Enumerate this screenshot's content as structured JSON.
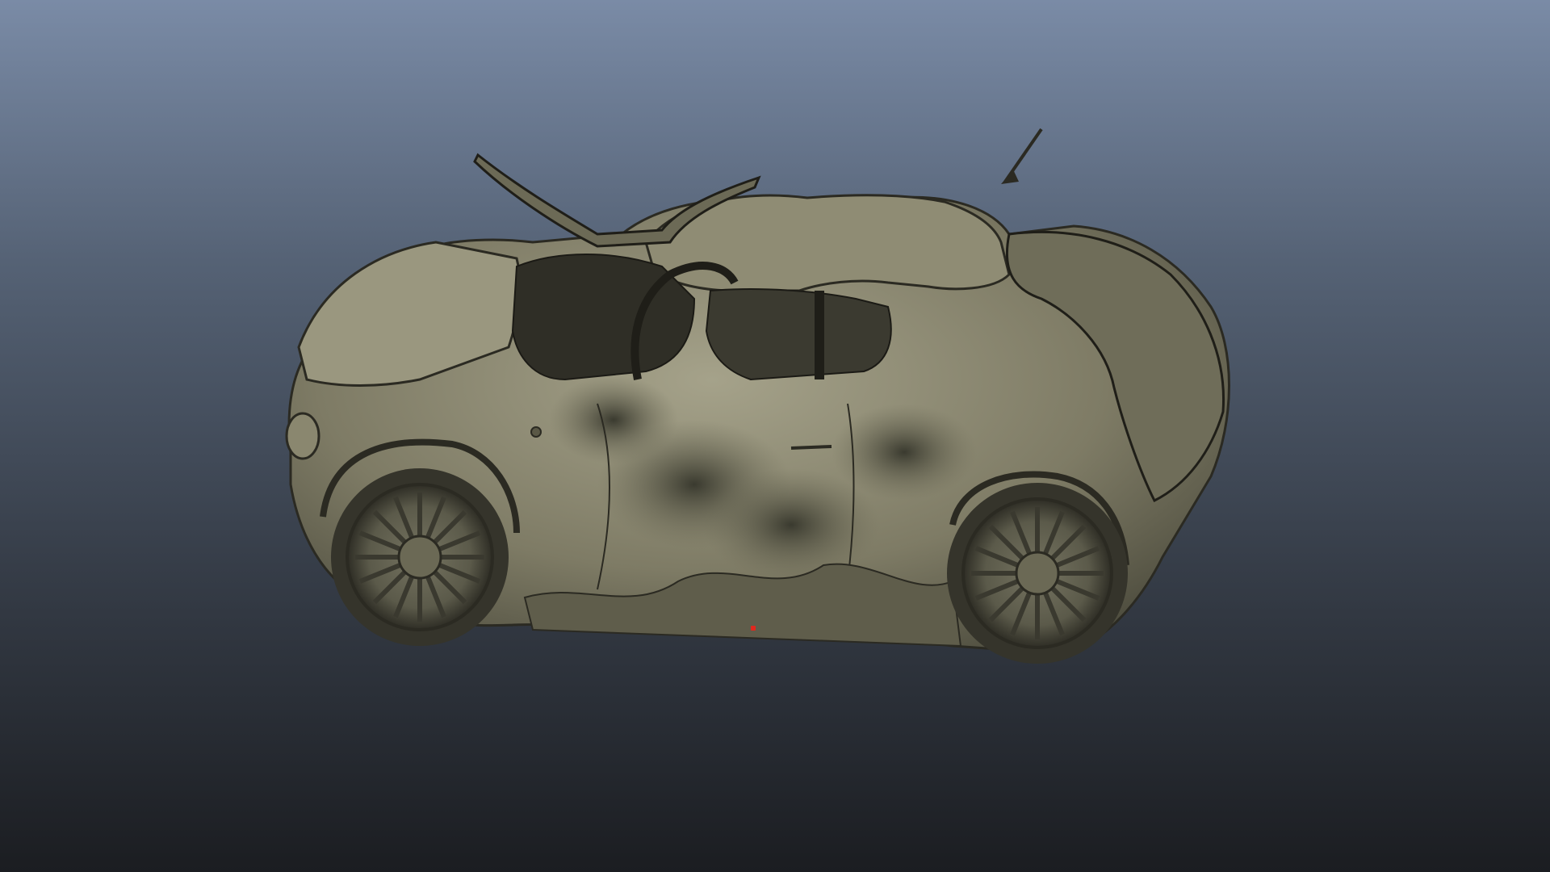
{
  "viewport": {
    "background_top": "#7a8ba6",
    "background_bottom": "#1b1d21"
  },
  "model": {
    "object": "crashed-car-mesh",
    "shading": "untextured-clay",
    "body_color": "#8d8a72",
    "shadow_color": "#2b2a22",
    "highlight_color": "#aeac94"
  },
  "pivot": {
    "icon": "pivot-point-icon",
    "color": "#e0281e"
  }
}
